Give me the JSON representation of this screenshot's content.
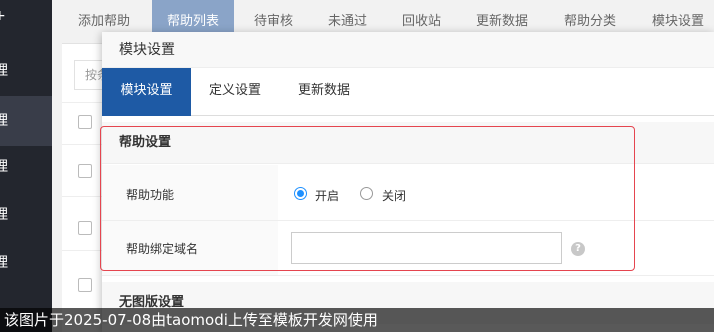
{
  "sidebar": {
    "top_glyph": "+",
    "items": [
      "理",
      "理",
      "理",
      "理",
      "理"
    ]
  },
  "tabs": [
    "添加帮助",
    "帮助列表",
    "待审核",
    "未通过",
    "回收站",
    "更新数据",
    "帮助分类",
    "模块设置"
  ],
  "background": {
    "search_placeholder": "按条"
  },
  "modal": {
    "title": "模块设置",
    "tabs": [
      "模块设置",
      "定义设置",
      "更新数据"
    ],
    "section1": {
      "heading": "帮助设置",
      "function_label": "帮助功能",
      "radio_on": "开启",
      "radio_off": "关闭",
      "domain_label": "帮助绑定域名",
      "domain_value": "",
      "help_icon": "?"
    },
    "section2": {
      "heading": "无图版设置"
    }
  },
  "watermark": "该图片于2025-07-08由taomodi上传至模板开发网使用",
  "colors": {
    "sidebar_bg": "#23262e",
    "tab_active": "#8aa4c8",
    "modal_tab_active": "#1e5aa5",
    "radio_blue": "#1e90ff",
    "highlight_red": "#e5454f"
  }
}
